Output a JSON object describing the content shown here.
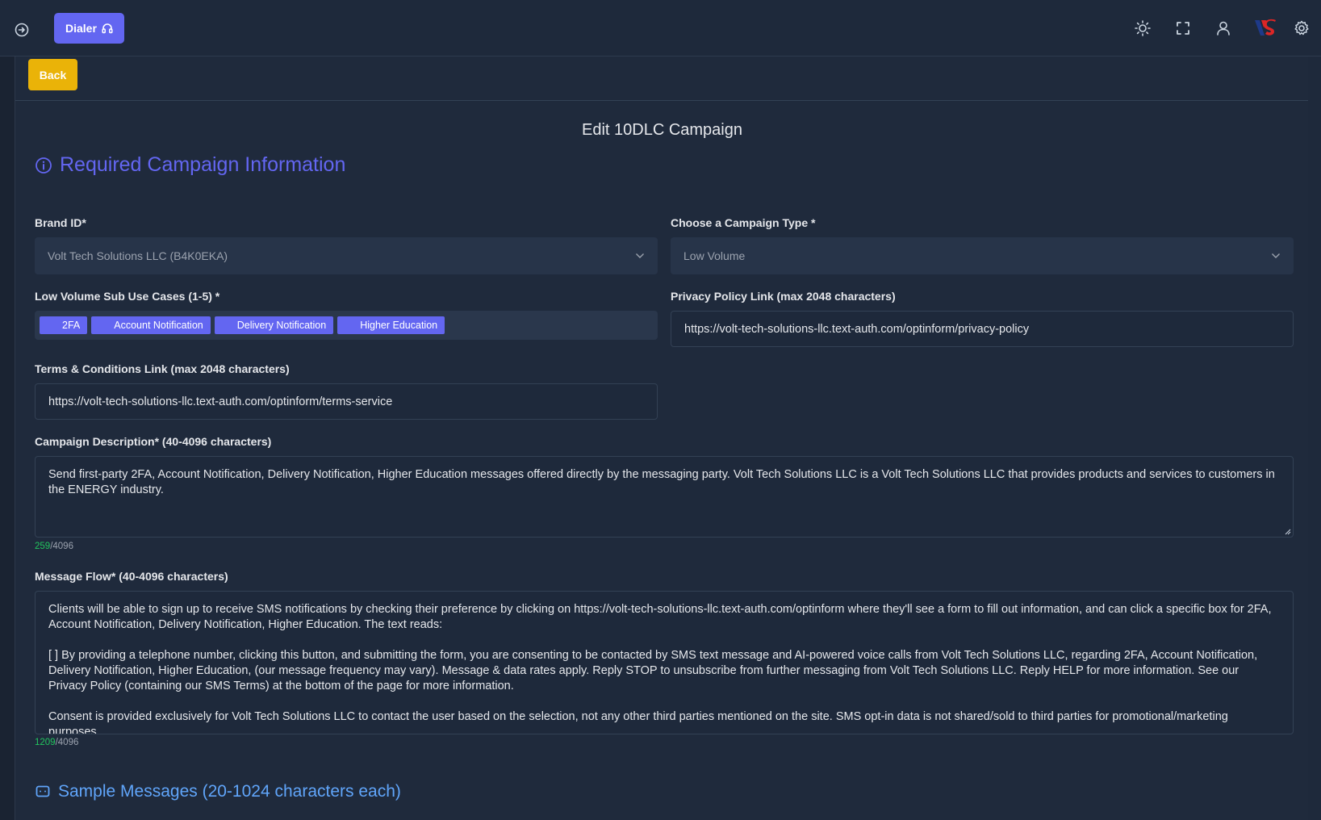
{
  "topbar": {
    "dialer_label": "Dialer",
    "icons": [
      "nav-toggle-icon",
      "headset-icon",
      "sun-icon",
      "fullscreen-icon",
      "user-icon",
      "brand-logo",
      "gear-icon"
    ]
  },
  "back_label": "Back",
  "page_title": "Edit 10DLC Campaign",
  "required_section": {
    "title": "Required Campaign Information"
  },
  "brand": {
    "label": "Brand ID*",
    "value": "Volt Tech Solutions LLC (B4K0EKA)"
  },
  "campaign_type": {
    "label": "Choose a Campaign Type *",
    "value": "Low Volume"
  },
  "sub_use_cases": {
    "label": "Low Volume Sub Use Cases (1-5) *",
    "tags": [
      "2FA",
      "Account Notification",
      "Delivery Notification",
      "Higher Education"
    ]
  },
  "privacy": {
    "label": "Privacy Policy Link (max 2048 characters)",
    "value": "https://volt-tech-solutions-llc.text-auth.com/optinform/privacy-policy"
  },
  "terms": {
    "label": "Terms & Conditions Link (max 2048 characters)",
    "value": "https://volt-tech-solutions-llc.text-auth.com/optinform/terms-service"
  },
  "description": {
    "label": "Campaign Description* (40-4096 characters)",
    "value": "Send first-party 2FA, Account Notification, Delivery Notification, Higher Education messages offered directly by the messaging party. Volt Tech Solutions LLC is a Volt Tech Solutions LLC that provides products and services to customers in the ENERGY industry.",
    "count": "259",
    "max": "/4096"
  },
  "message_flow": {
    "label": "Message Flow* (40-4096 characters)",
    "paragraphs": [
      "Clients will be able to sign up to receive SMS notifications by checking their preference by clicking on https://volt-tech-solutions-llc.text-auth.com/optinform where they'll see a form to fill out information, and can click a specific box for 2FA, Account Notification, Delivery Notification, Higher Education. The text reads:",
      "[ ] By providing a telephone number, clicking this button, and submitting the form, you are consenting to be contacted by SMS text message and AI-powered voice calls from Volt Tech Solutions LLC, regarding 2FA, Account Notification, Delivery Notification, Higher Education, (our message frequency may vary). Message & data rates apply. Reply STOP to unsubscribe from further messaging from Volt Tech Solutions LLC. Reply HELP for more information. See our Privacy Policy (containing our SMS Terms) at the bottom of the page for more information.",
      "Consent is provided exclusively for Volt Tech Solutions LLC to contact the user based on the selection, not any other third parties mentioned on the site. SMS opt-in data is not shared/sold to third parties for promotional/marketing purposes."
    ],
    "count": "1209",
    "max": "/4096"
  },
  "samples_section": {
    "title": "Sample Messages (20-1024 characters each)"
  },
  "colors": {
    "accent": "#6366f1",
    "back": "#eab308",
    "count": "#22c55e",
    "bg": "#1e293b"
  }
}
